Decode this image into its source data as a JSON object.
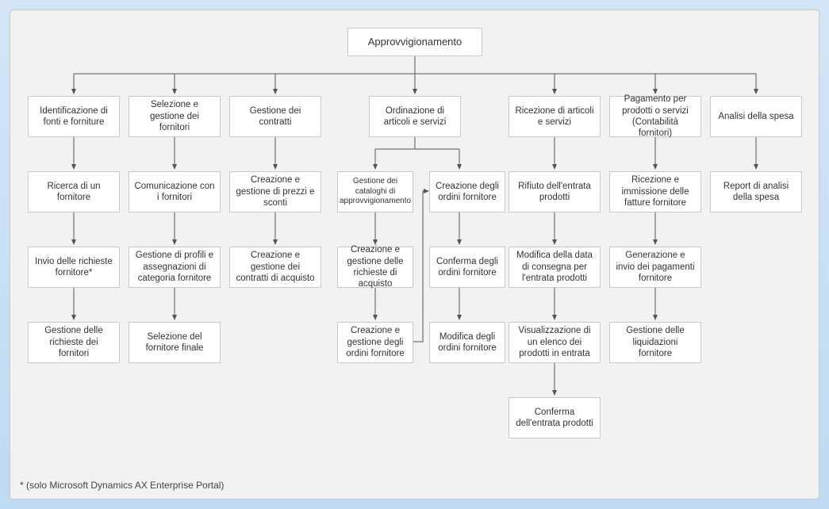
{
  "root": "Approvvigionamento",
  "columns": {
    "c1": {
      "header": "Identificazione di fonti e forniture",
      "r1": "Ricerca di un fornitore",
      "r2": "Invio delle richieste fornitore*",
      "r3": "Gestione delle richieste dei fornitori"
    },
    "c2": {
      "header": "Selezione e gestione dei fornitori",
      "r1": "Comunicazione con i fornitori",
      "r2": "Gestione di profili e assegnazioni di categoria fornitore",
      "r3": "Selezione del fornitore finale"
    },
    "c3": {
      "header": "Gestione dei contratti",
      "r1": "Creazione e gestione di prezzi e sconti",
      "r2": "Creazione e gestione dei contratti di acquisto"
    },
    "c4": {
      "header": "Ordinazione di articoli e servizi",
      "left": {
        "r1": "Gestione dei cataloghi di approvvigionamento",
        "r2": "Creazione e gestione delle richieste di acquisto",
        "r3": "Creazione e gestione degli ordini fornitore"
      },
      "right": {
        "r1": "Creazione degli ordini fornitore",
        "r2": "Conferma degli ordini fornitore",
        "r3": "Modifica degli ordini fornitore"
      }
    },
    "c5": {
      "header": "Ricezione di articoli e servizi",
      "r1": "Rifiuto dell'entrata prodotti",
      "r2": "Modifica della data di consegna per l'entrata prodotti",
      "r3": "Visualizzazione di un elenco dei prodotti in entrata",
      "r4": "Conferma dell'entrata prodotti"
    },
    "c6": {
      "header": "Pagamento per prodotti o servizi (Contabilità fornitori)",
      "r1": "Ricezione e immissione delle fatture fornitore",
      "r2": "Generazione e invio dei pagamenti fornitore",
      "r3": "Gestione delle liquidazioni fornitore"
    },
    "c7": {
      "header": "Analisi della spesa",
      "r1": "Report di analisi della spesa"
    }
  },
  "footnote": "* (solo Microsoft Dynamics AX Enterprise Portal)"
}
